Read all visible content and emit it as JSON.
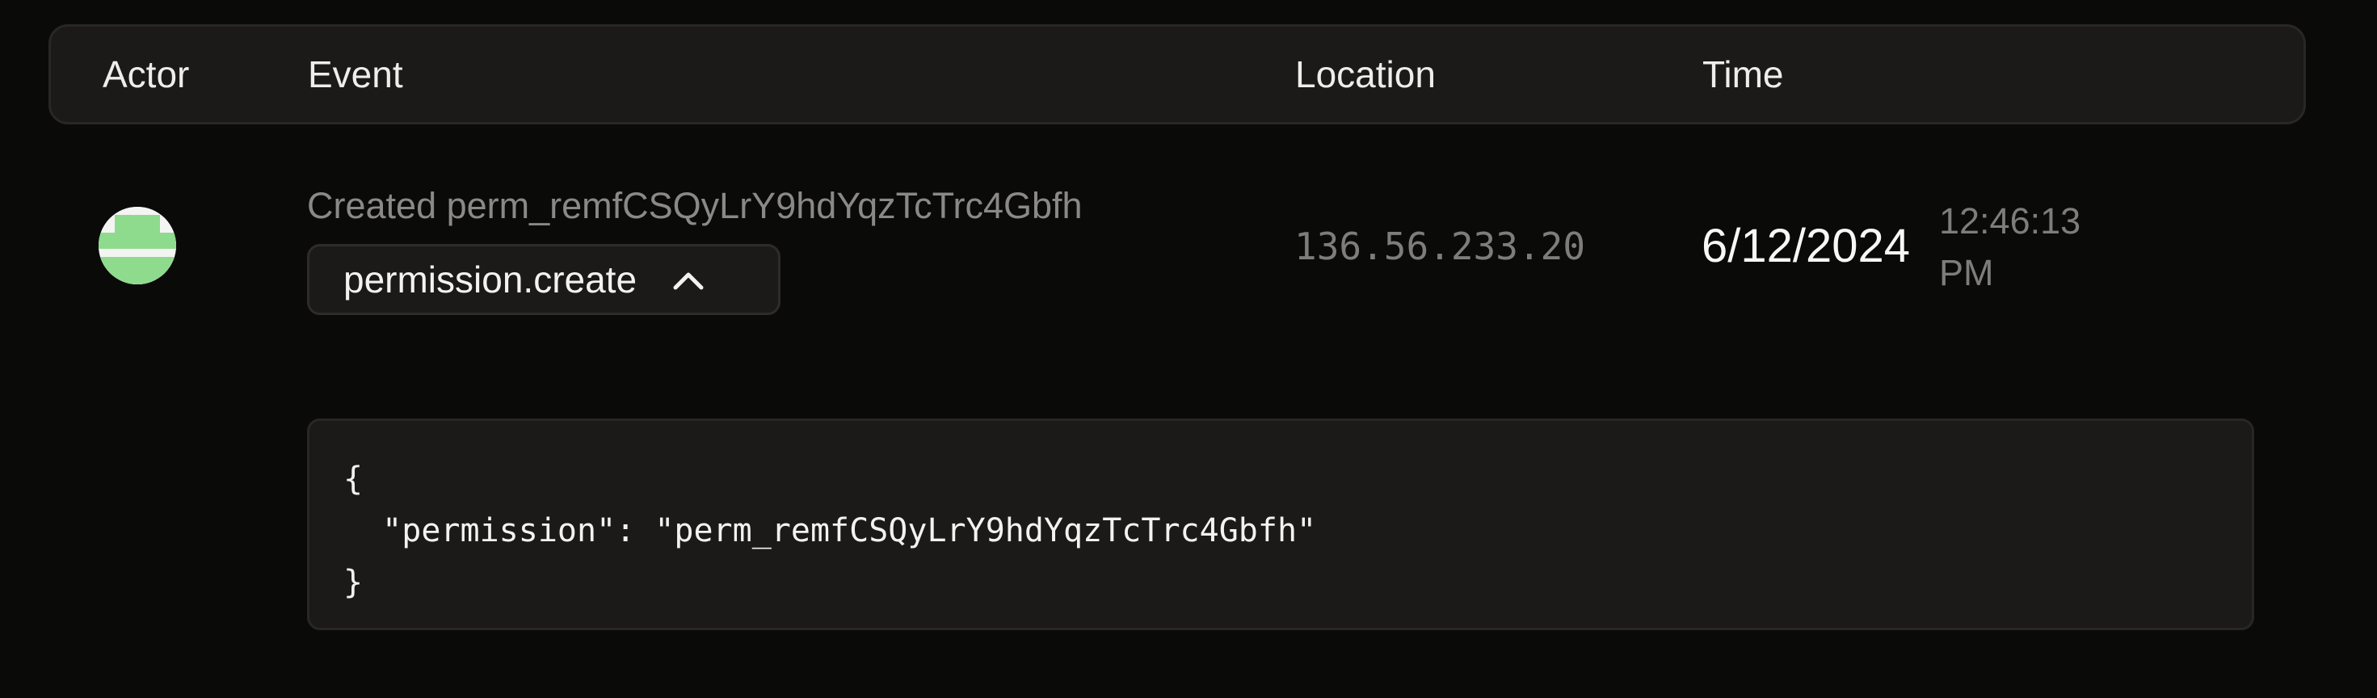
{
  "table": {
    "columns": {
      "actor": "Actor",
      "event": "Event",
      "location": "Location",
      "time": "Time"
    }
  },
  "row": {
    "actor_icon": "user-avatar-icon",
    "event_description": "Created perm_remfCSQyLrY9hdYqzTcTrc4Gbfh",
    "event_type": "permission.create",
    "expanded_indicator": "chevron-up-icon",
    "location": "136.56.233.20",
    "date": "6/12/2024",
    "time_line1": "12:46:13",
    "time_line2": "PM",
    "details": {
      "line1": "{",
      "line2": "  \"permission\": \"perm_remfCSQyLrY9hdYqzTcTrc4Gbfh\"",
      "line3": "}"
    }
  },
  "colors": {
    "background": "#0a0a09",
    "panel": "#1c1a19",
    "avatar_green": "#8fdb8d"
  }
}
